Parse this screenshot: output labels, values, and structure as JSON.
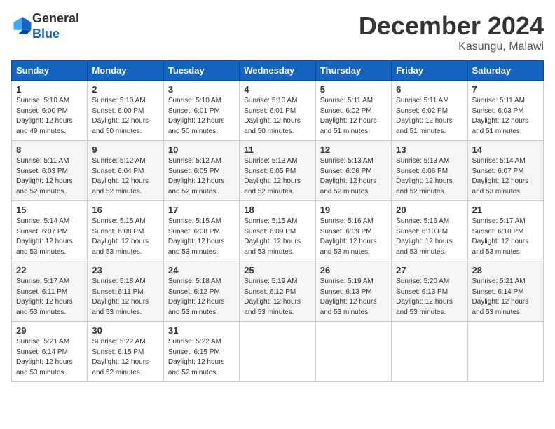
{
  "header": {
    "logo_general": "General",
    "logo_blue": "Blue",
    "month_title": "December 2024",
    "location": "Kasungu, Malawi"
  },
  "calendar": {
    "days_of_week": [
      "Sunday",
      "Monday",
      "Tuesday",
      "Wednesday",
      "Thursday",
      "Friday",
      "Saturday"
    ],
    "weeks": [
      [
        {
          "day": "1",
          "sunrise": "5:10 AM",
          "sunset": "6:00 PM",
          "daylight": "12 hours and 49 minutes."
        },
        {
          "day": "2",
          "sunrise": "5:10 AM",
          "sunset": "6:00 PM",
          "daylight": "12 hours and 50 minutes."
        },
        {
          "day": "3",
          "sunrise": "5:10 AM",
          "sunset": "6:01 PM",
          "daylight": "12 hours and 50 minutes."
        },
        {
          "day": "4",
          "sunrise": "5:10 AM",
          "sunset": "6:01 PM",
          "daylight": "12 hours and 50 minutes."
        },
        {
          "day": "5",
          "sunrise": "5:11 AM",
          "sunset": "6:02 PM",
          "daylight": "12 hours and 51 minutes."
        },
        {
          "day": "6",
          "sunrise": "5:11 AM",
          "sunset": "6:02 PM",
          "daylight": "12 hours and 51 minutes."
        },
        {
          "day": "7",
          "sunrise": "5:11 AM",
          "sunset": "6:03 PM",
          "daylight": "12 hours and 51 minutes."
        }
      ],
      [
        {
          "day": "8",
          "sunrise": "5:11 AM",
          "sunset": "6:03 PM",
          "daylight": "12 hours and 52 minutes."
        },
        {
          "day": "9",
          "sunrise": "5:12 AM",
          "sunset": "6:04 PM",
          "daylight": "12 hours and 52 minutes."
        },
        {
          "day": "10",
          "sunrise": "5:12 AM",
          "sunset": "6:05 PM",
          "daylight": "12 hours and 52 minutes."
        },
        {
          "day": "11",
          "sunrise": "5:13 AM",
          "sunset": "6:05 PM",
          "daylight": "12 hours and 52 minutes."
        },
        {
          "day": "12",
          "sunrise": "5:13 AM",
          "sunset": "6:06 PM",
          "daylight": "12 hours and 52 minutes."
        },
        {
          "day": "13",
          "sunrise": "5:13 AM",
          "sunset": "6:06 PM",
          "daylight": "12 hours and 52 minutes."
        },
        {
          "day": "14",
          "sunrise": "5:14 AM",
          "sunset": "6:07 PM",
          "daylight": "12 hours and 53 minutes."
        }
      ],
      [
        {
          "day": "15",
          "sunrise": "5:14 AM",
          "sunset": "6:07 PM",
          "daylight": "12 hours and 53 minutes."
        },
        {
          "day": "16",
          "sunrise": "5:15 AM",
          "sunset": "6:08 PM",
          "daylight": "12 hours and 53 minutes."
        },
        {
          "day": "17",
          "sunrise": "5:15 AM",
          "sunset": "6:08 PM",
          "daylight": "12 hours and 53 minutes."
        },
        {
          "day": "18",
          "sunrise": "5:15 AM",
          "sunset": "6:09 PM",
          "daylight": "12 hours and 53 minutes."
        },
        {
          "day": "19",
          "sunrise": "5:16 AM",
          "sunset": "6:09 PM",
          "daylight": "12 hours and 53 minutes."
        },
        {
          "day": "20",
          "sunrise": "5:16 AM",
          "sunset": "6:10 PM",
          "daylight": "12 hours and 53 minutes."
        },
        {
          "day": "21",
          "sunrise": "5:17 AM",
          "sunset": "6:10 PM",
          "daylight": "12 hours and 53 minutes."
        }
      ],
      [
        {
          "day": "22",
          "sunrise": "5:17 AM",
          "sunset": "6:11 PM",
          "daylight": "12 hours and 53 minutes."
        },
        {
          "day": "23",
          "sunrise": "5:18 AM",
          "sunset": "6:11 PM",
          "daylight": "12 hours and 53 minutes."
        },
        {
          "day": "24",
          "sunrise": "5:18 AM",
          "sunset": "6:12 PM",
          "daylight": "12 hours and 53 minutes."
        },
        {
          "day": "25",
          "sunrise": "5:19 AM",
          "sunset": "6:12 PM",
          "daylight": "12 hours and 53 minutes."
        },
        {
          "day": "26",
          "sunrise": "5:19 AM",
          "sunset": "6:13 PM",
          "daylight": "12 hours and 53 minutes."
        },
        {
          "day": "27",
          "sunrise": "5:20 AM",
          "sunset": "6:13 PM",
          "daylight": "12 hours and 53 minutes."
        },
        {
          "day": "28",
          "sunrise": "5:21 AM",
          "sunset": "6:14 PM",
          "daylight": "12 hours and 53 minutes."
        }
      ],
      [
        {
          "day": "29",
          "sunrise": "5:21 AM",
          "sunset": "6:14 PM",
          "daylight": "12 hours and 53 minutes."
        },
        {
          "day": "30",
          "sunrise": "5:22 AM",
          "sunset": "6:15 PM",
          "daylight": "12 hours and 52 minutes."
        },
        {
          "day": "31",
          "sunrise": "5:22 AM",
          "sunset": "6:15 PM",
          "daylight": "12 hours and 52 minutes."
        },
        null,
        null,
        null,
        null
      ]
    ]
  }
}
